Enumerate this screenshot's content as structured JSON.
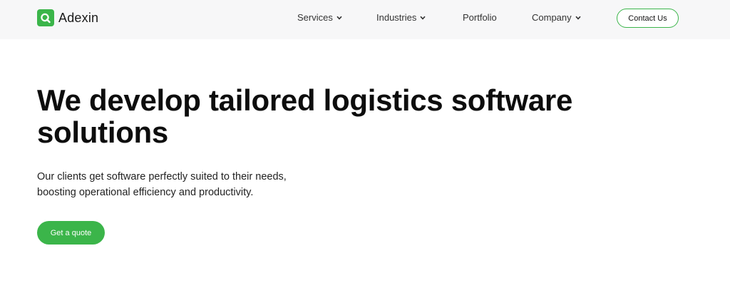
{
  "brand": {
    "name": "Adexin",
    "accent_color": "#3bb54a",
    "logo_icon": "adexin-logo-icon"
  },
  "nav": {
    "items": [
      {
        "label": "Services",
        "has_dropdown": true
      },
      {
        "label": "Industries",
        "has_dropdown": true
      },
      {
        "label": "Portfolio",
        "has_dropdown": false
      },
      {
        "label": "Company",
        "has_dropdown": true
      }
    ],
    "contact_label": "Contact Us"
  },
  "hero": {
    "title": "We develop tailored logistics software solutions",
    "subtitle_line1": "Our clients get software perfectly suited to their needs,",
    "subtitle_line2": "boosting operational efficiency and productivity.",
    "cta_label": "Get a quote"
  }
}
